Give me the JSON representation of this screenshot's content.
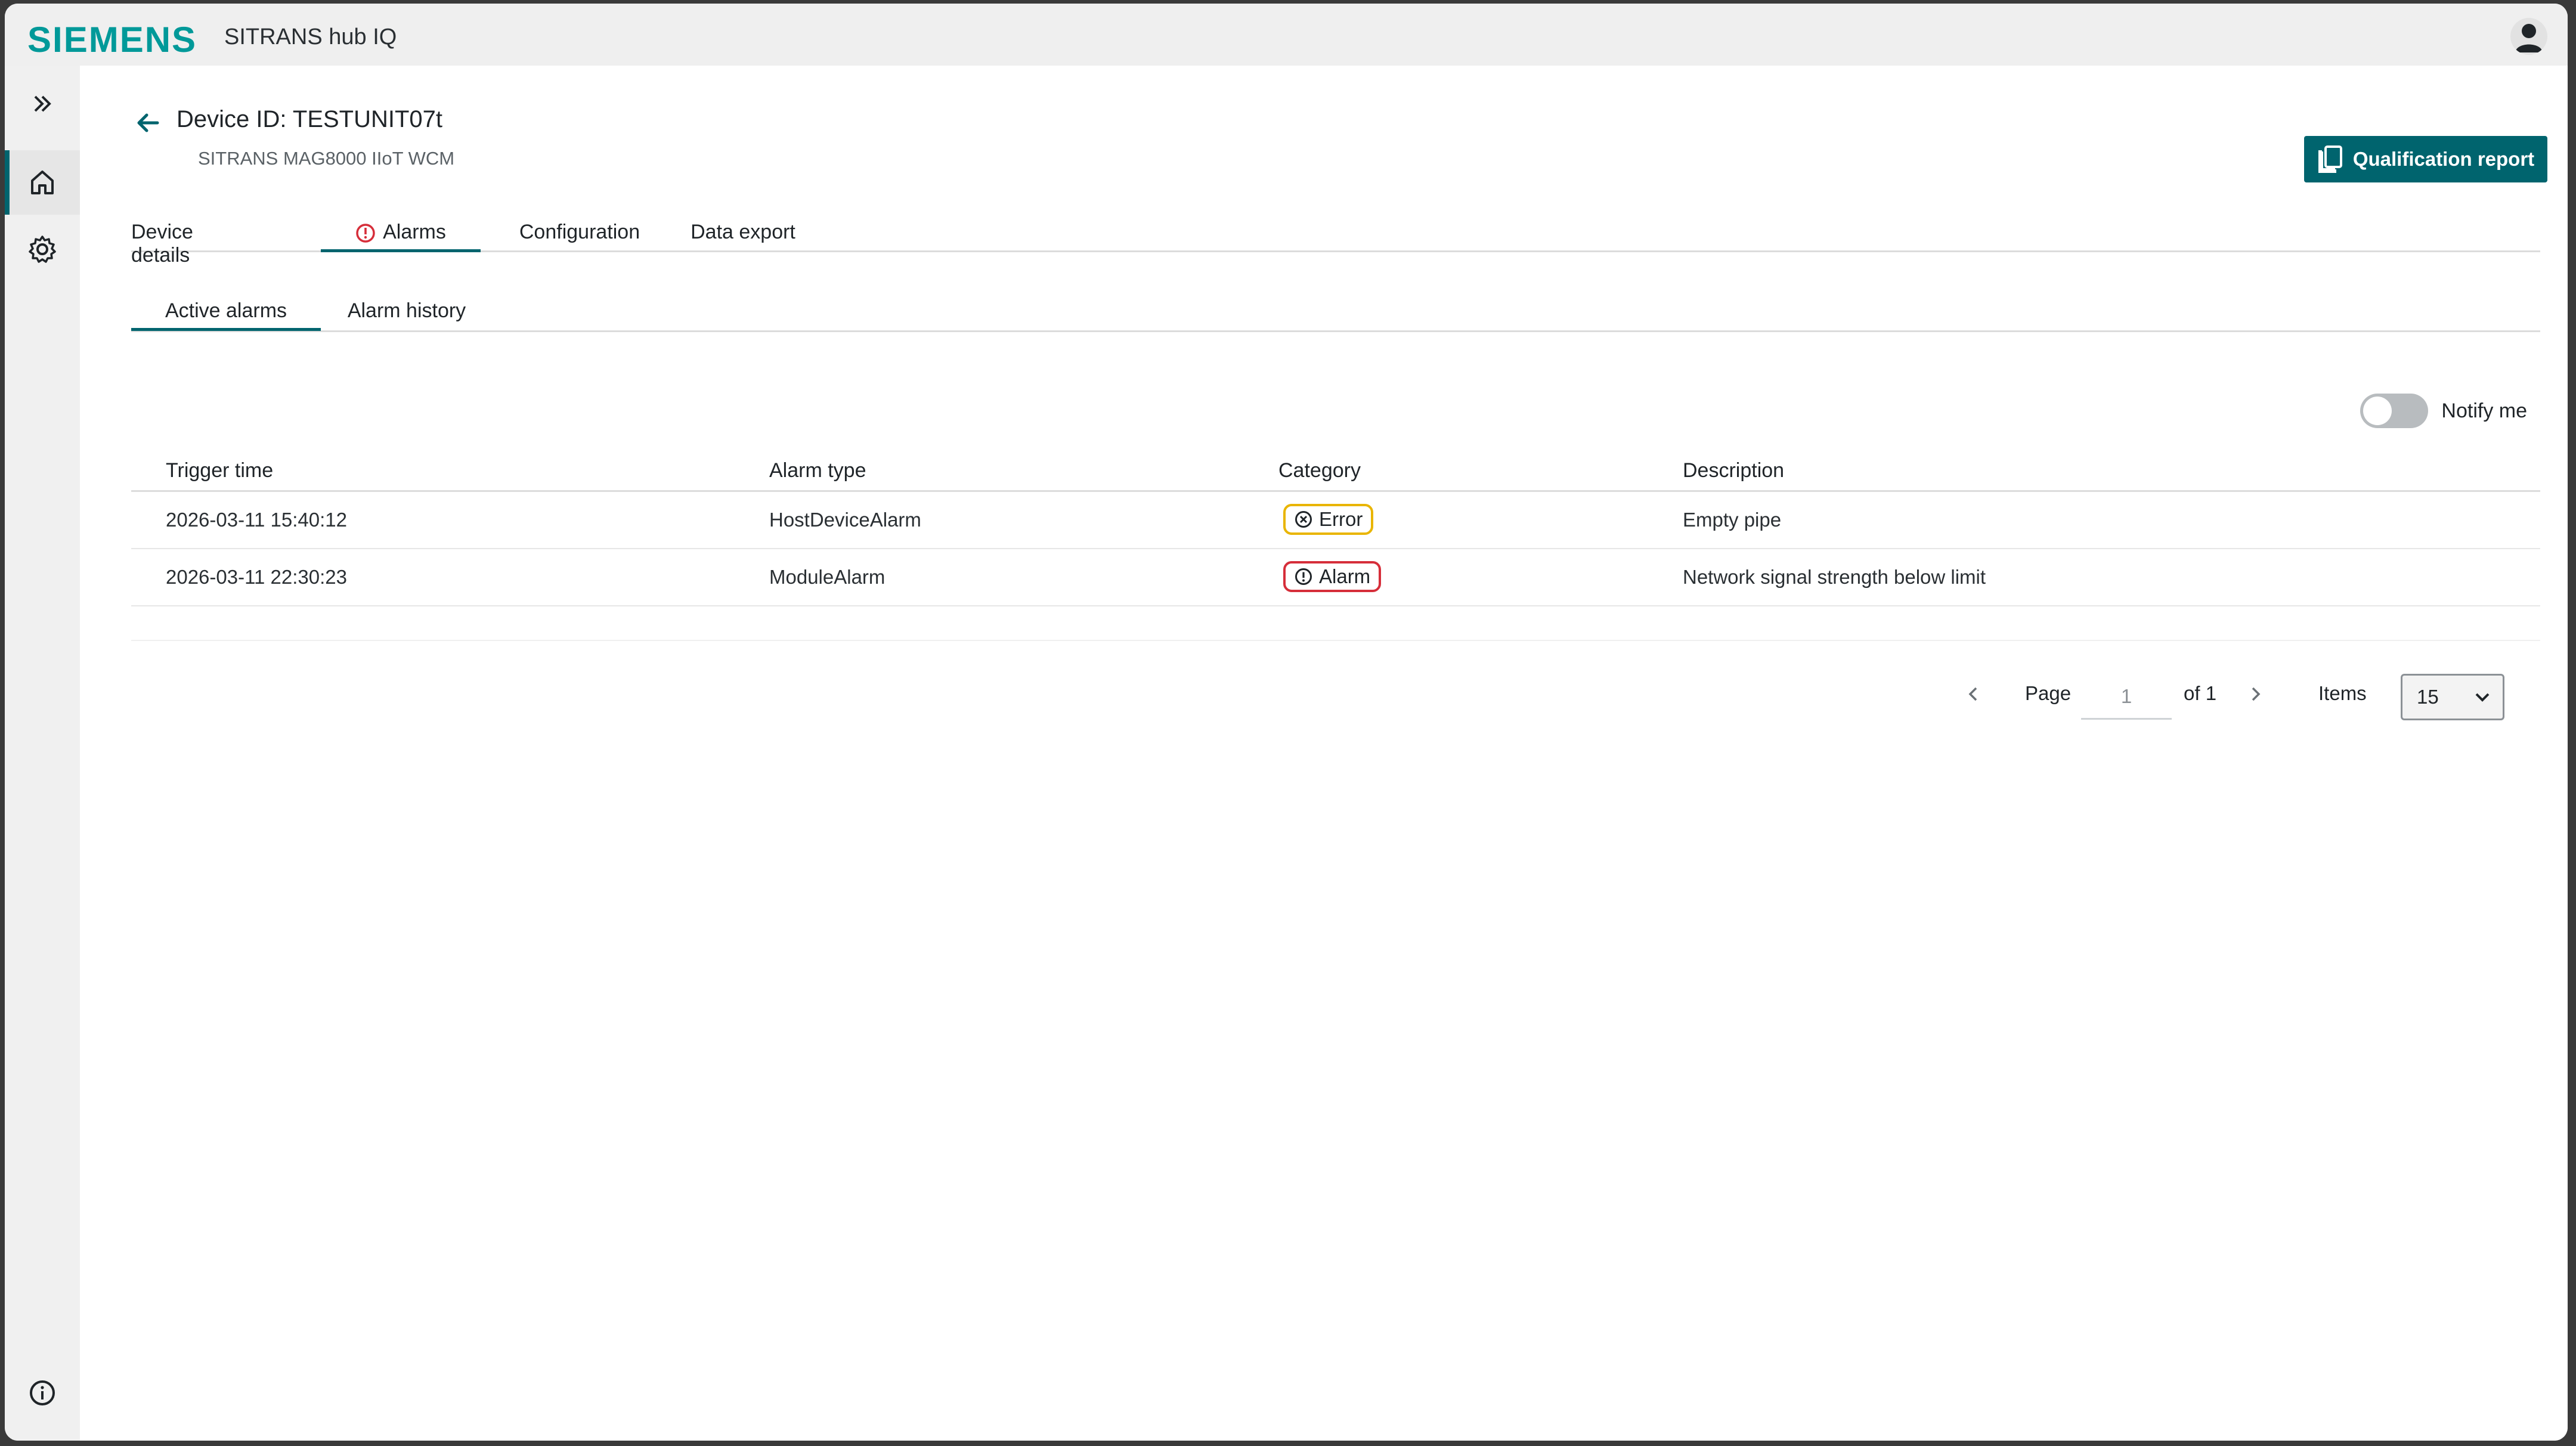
{
  "header": {
    "brand": "SIEMENS",
    "app_title": "SITRANS hub IQ"
  },
  "sidebar": {
    "items": [
      {
        "icon": "double-chevron-right-icon"
      },
      {
        "icon": "home-icon",
        "active": true
      },
      {
        "icon": "gear-icon"
      },
      {
        "icon": "info-icon"
      }
    ]
  },
  "device": {
    "title": "Device ID: TESTUNIT07t",
    "subtitle": "SITRANS MAG8000 IIoT WCM",
    "qualification_label": "Qualification report"
  },
  "tabs": [
    {
      "label": "Device details"
    },
    {
      "label": "Alarms",
      "active": true
    },
    {
      "label": "Configuration"
    },
    {
      "label": "Data export"
    }
  ],
  "subtabs": [
    {
      "label": "Active alarms",
      "active": true
    },
    {
      "label": "Alarm history"
    }
  ],
  "notify": {
    "label": "Notify me",
    "enabled": false
  },
  "table": {
    "columns": [
      "Trigger time",
      "Alarm type",
      "Category",
      "Description"
    ],
    "rows": [
      {
        "time": "2026-03-11 15:40:12",
        "type": "HostDeviceAlarm",
        "category": "Error",
        "description": "Empty pipe"
      },
      {
        "time": "2026-03-11 22:30:23",
        "type": "ModuleAlarm",
        "category": "Alarm",
        "description": "Network signal strength below limit"
      }
    ]
  },
  "pagination": {
    "page_label": "Page",
    "page_value": "1",
    "of_label": "of 1",
    "items_label": "Items",
    "items_value": "15"
  },
  "colors": {
    "brand": "#009999",
    "accent": "#00646e",
    "error": "#e9b500",
    "alarm": "#d62e3a"
  }
}
